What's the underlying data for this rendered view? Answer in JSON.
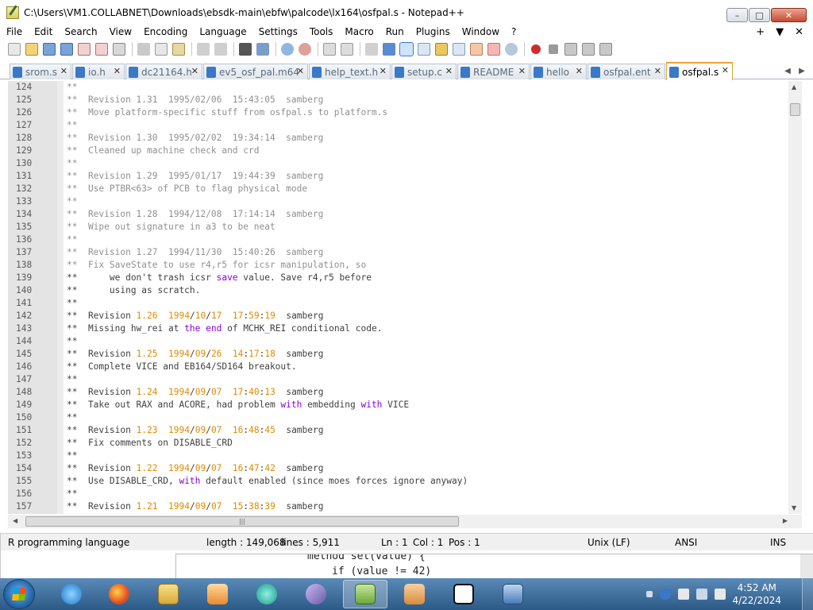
{
  "window": {
    "title": "C:\\Users\\VM1.COLLABNET\\Downloads\\ebsdk-main\\ebfw\\palcode\\lx164\\osfpal.s - Notepad++",
    "minimize": "–",
    "maximize": "□",
    "close": "✕"
  },
  "menu": {
    "items": [
      "File",
      "Edit",
      "Search",
      "View",
      "Encoding",
      "Language",
      "Settings",
      "Tools",
      "Macro",
      "Run",
      "Plugins",
      "Window",
      "?"
    ],
    "right": [
      "+",
      "▼",
      "✕"
    ]
  },
  "tabs": [
    {
      "label": "srom.s"
    },
    {
      "label": "io.h"
    },
    {
      "label": "dc21164.h"
    },
    {
      "label": "ev5_osf_pal.m64"
    },
    {
      "label": "help_text.h"
    },
    {
      "label": "setup.c"
    },
    {
      "label": "README"
    },
    {
      "label": "hello"
    },
    {
      "label": "osfpal.ent"
    },
    {
      "label": "osfpal.s",
      "active": true
    }
  ],
  "tab_close": "✕",
  "tab_scroll": [
    "◀",
    "▶"
  ],
  "editor": {
    "lines": [
      {
        "n": "124",
        "t": "**",
        "dim": true
      },
      {
        "n": "125",
        "t": "**  Revision 1.31  1995/02/06  15:43:05  samberg",
        "dim": true
      },
      {
        "n": "126",
        "t": "**  Move platform-specific stuff from osfpal.s to platform.s",
        "dim": true
      },
      {
        "n": "127",
        "t": "**",
        "dim": true
      },
      {
        "n": "128",
        "t": "**  Revision 1.30  1995/02/02  19:34:14  samberg",
        "dim": true
      },
      {
        "n": "129",
        "t": "**  Cleaned up machine check and crd",
        "dim": true
      },
      {
        "n": "130",
        "t": "**",
        "dim": true
      },
      {
        "n": "131",
        "t": "**  Revision 1.29  1995/01/17  19:44:39  samberg",
        "dim": true
      },
      {
        "n": "132",
        "t": "**  Use PTBR<63> of PCB to flag physical mode",
        "dim": true
      },
      {
        "n": "133",
        "t": "**",
        "dim": true
      },
      {
        "n": "134",
        "t": "**  Revision 1.28  1994/12/08  17:14:14  samberg",
        "dim": true
      },
      {
        "n": "135",
        "t": "**  Wipe out signature in a3 to be neat",
        "dim": true
      },
      {
        "n": "136",
        "t": "**",
        "dim": true
      },
      {
        "n": "137",
        "t": "**  Revision 1.27  1994/11/30  15:40:26  samberg",
        "dim": true
      },
      {
        "n": "138",
        "t": "**  Fix SaveState to use r4,r5 for icsr manipulation, so",
        "dim": true
      },
      {
        "n": "139",
        "t": "**      we don't trash icsr save value. Save r4,r5 before"
      },
      {
        "n": "140",
        "t": "**      using as scratch."
      },
      {
        "n": "141",
        "t": "**"
      },
      {
        "n": "142",
        "t": "**  Revision 1.26  1994/10/17  17:59:19  samberg"
      },
      {
        "n": "143",
        "t": "**  Missing hw_rei at the end of MCHK_REI conditional code."
      },
      {
        "n": "144",
        "t": "**"
      },
      {
        "n": "145",
        "t": "**  Revision 1.25  1994/09/26  14:17:18  samberg"
      },
      {
        "n": "146",
        "t": "**  Complete VICE and EB164/SD164 breakout."
      },
      {
        "n": "147",
        "t": "**"
      },
      {
        "n": "148",
        "t": "**  Revision 1.24  1994/09/07  17:40:13  samberg"
      },
      {
        "n": "149",
        "t": "**  Take out RAX and ACORE, had problem with embedding with VICE"
      },
      {
        "n": "150",
        "t": "**"
      },
      {
        "n": "151",
        "t": "**  Revision 1.23  1994/09/07  16:48:45  samberg"
      },
      {
        "n": "152",
        "t": "**  Fix comments on DISABLE_CRD"
      },
      {
        "n": "153",
        "t": "**"
      },
      {
        "n": "154",
        "t": "**  Revision 1.22  1994/09/07  16:47:42  samberg"
      },
      {
        "n": "155",
        "t": "**  Use DISABLE_CRD, with default enabled (since moes forces ignore anyway)"
      },
      {
        "n": "156",
        "t": "**"
      },
      {
        "n": "157",
        "t": "**  Revision 1.21  1994/09/07  15:38:39  samberg"
      }
    ]
  },
  "statusbar": {
    "language": "R programming language",
    "length": "length : 149,068",
    "lines": "lines : 5,911",
    "ln": "Ln : 1",
    "col": "Col : 1",
    "pos": "Pos : 1",
    "eol": "Unix (LF)",
    "encoding": "ANSI",
    "mode": "INS"
  },
  "background_window": {
    "line1": "method set(value) {",
    "line2": "if (value != 42)"
  },
  "taskbar": {
    "apps": [
      "internet-explorer",
      "firefox",
      "file-explorer",
      "media-player",
      "app-cyan",
      "app-wave",
      "notepad-plus-plus",
      "hxd",
      "7zip",
      "remote-desktop"
    ],
    "clock_time": "4:52 AM",
    "clock_date": "4/22/2024"
  }
}
